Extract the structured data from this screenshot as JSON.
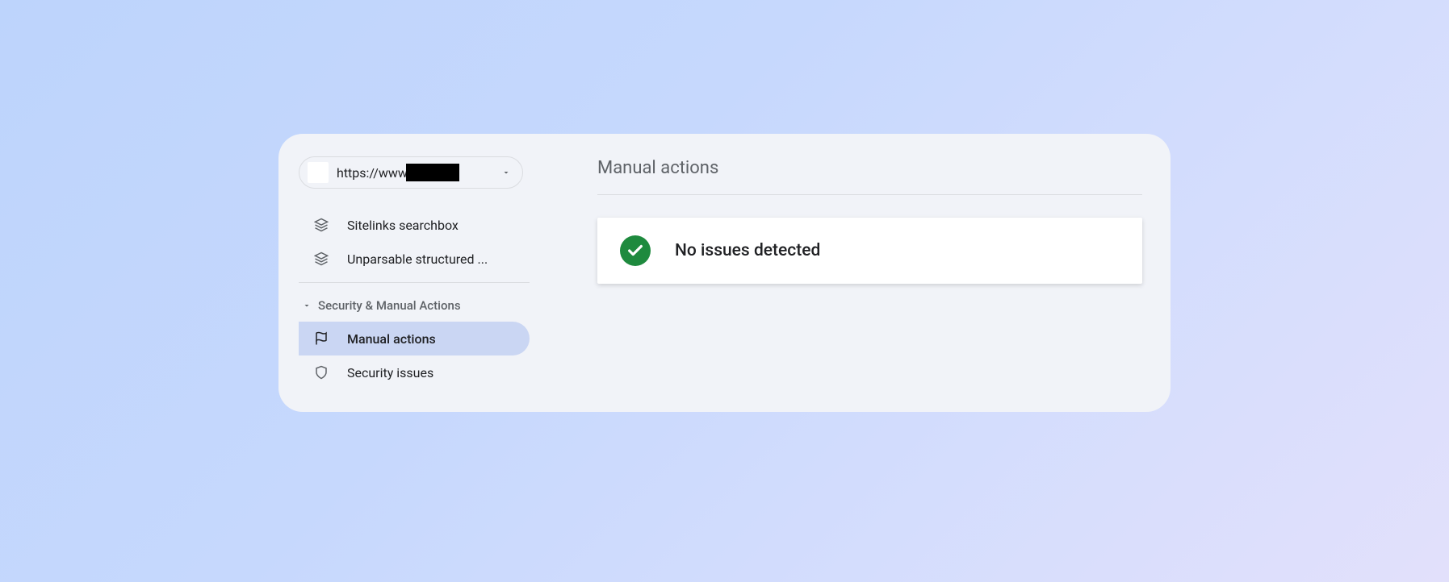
{
  "property": {
    "url_prefix": "https://www"
  },
  "sidebar": {
    "items": [
      {
        "label": "Sitelinks searchbox"
      },
      {
        "label": "Unparsable structured ..."
      }
    ],
    "section_header": "Security & Manual Actions",
    "sub_items": [
      {
        "label": "Manual actions"
      },
      {
        "label": "Security issues"
      }
    ]
  },
  "main": {
    "title": "Manual actions",
    "status_message": "No issues detected"
  },
  "colors": {
    "success": "#1e8a3e",
    "active_bg": "#cad6f3"
  }
}
